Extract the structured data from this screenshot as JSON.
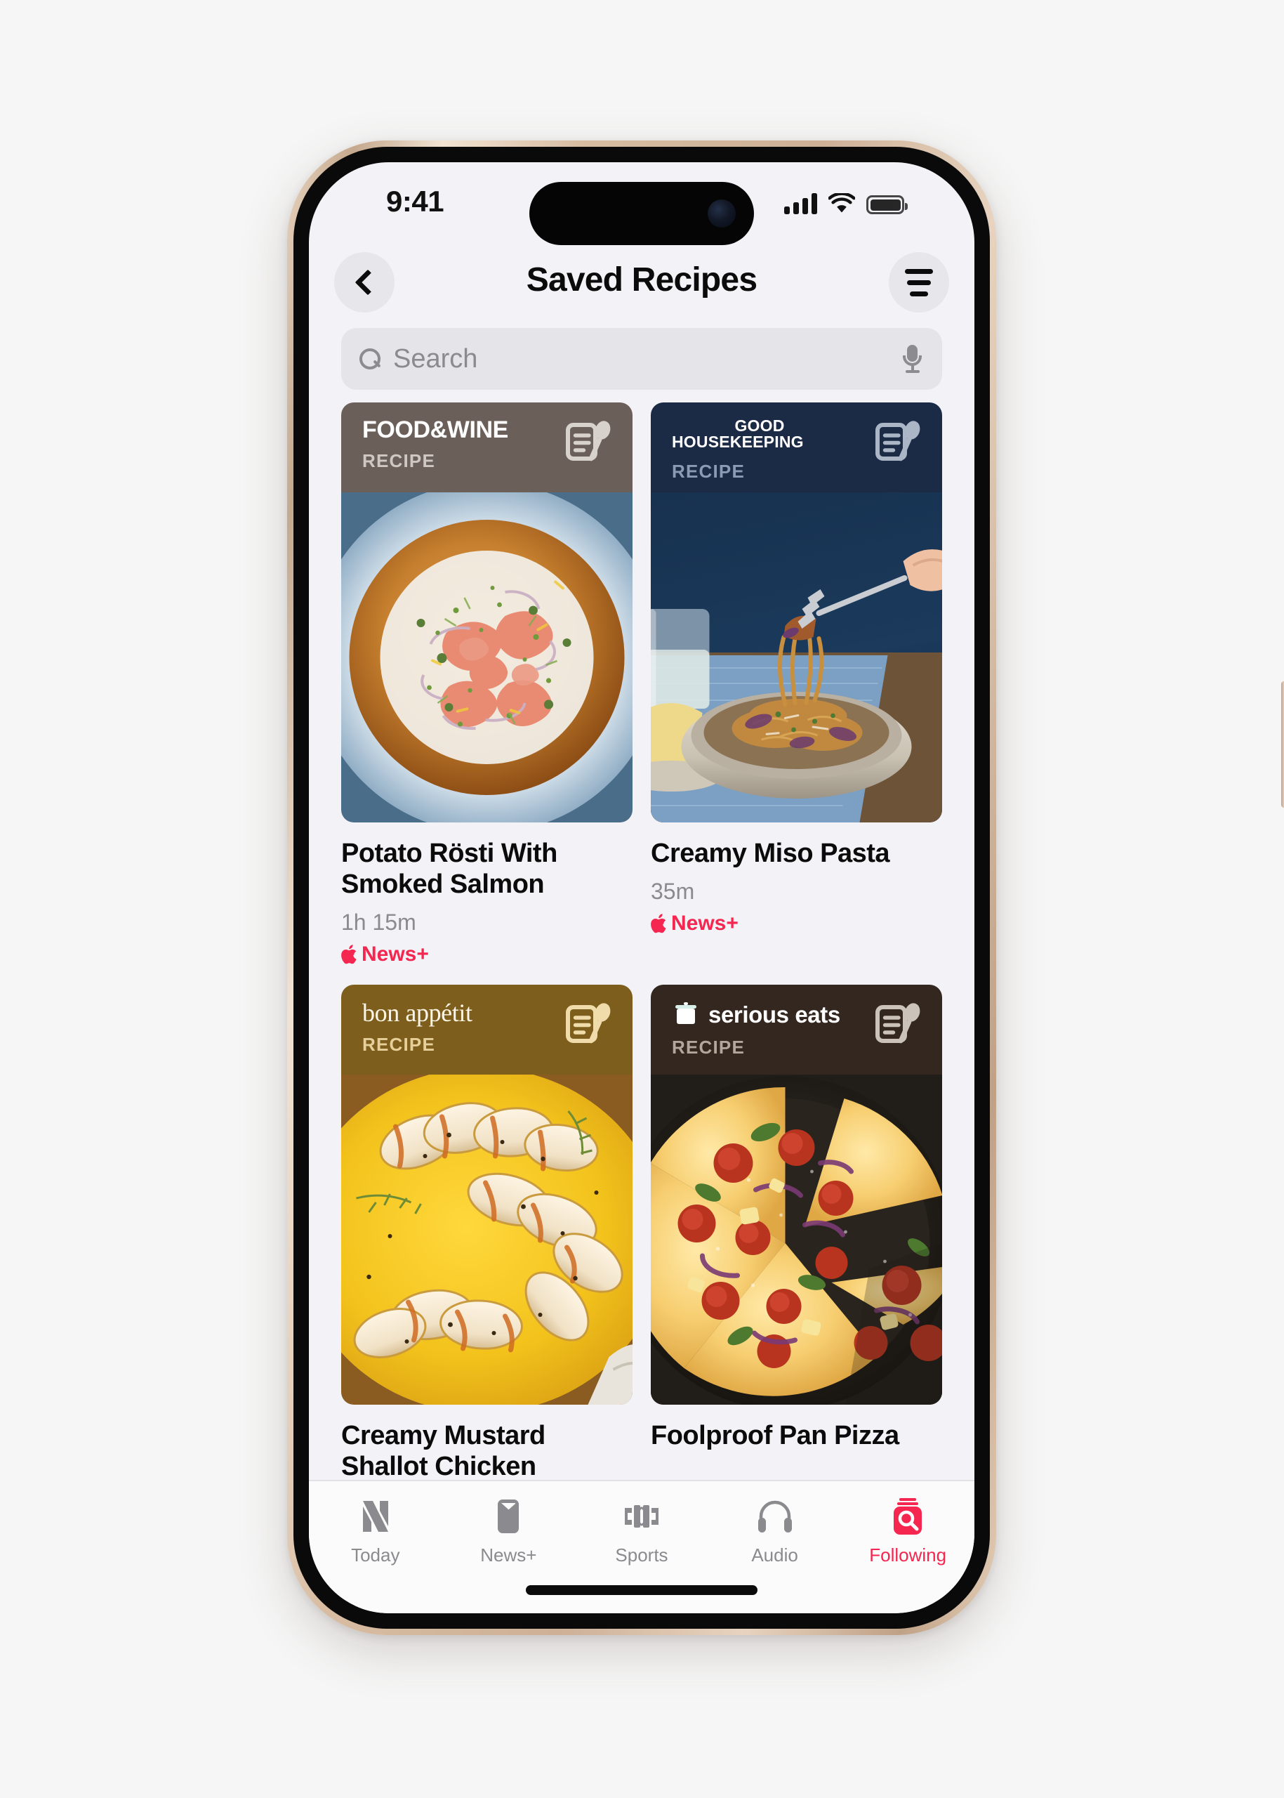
{
  "device": {
    "frame_color": "#d8bda3",
    "screen_bg": "#f2f2f7"
  },
  "status_bar": {
    "time": "9:41",
    "cellular_icon": "signal-bars-icon",
    "wifi_icon": "wifi-icon",
    "battery_icon": "battery-full-icon"
  },
  "nav": {
    "back_icon": "chevron-left-icon",
    "title": "Saved Recipes",
    "menu_icon": "filter-list-icon"
  },
  "search": {
    "placeholder": "Search",
    "value": "",
    "search_icon": "search-icon",
    "mic_icon": "microphone-icon"
  },
  "recipes": [
    {
      "publisher": "FOOD&WINE",
      "publisher_part1": "FOOD",
      "publisher_amp": "&",
      "publisher_part2": "WINE",
      "kind": "RECIPE",
      "header_bg": "#6b6059",
      "header_text": "#ffffff",
      "kind_color": "#cfc8c2",
      "icon": "recipe-card-icon",
      "icon_color": "#d8d2cc",
      "title": "Potato Rösti With Smoked Salmon",
      "time": "1h 15m",
      "badge": "News+",
      "badge_color": "#f5264f",
      "photo_alt": "potato-rosti-smoked-salmon-photo"
    },
    {
      "publisher": "GOOD HOUSEKEEPING",
      "publisher_line1": "GOOD",
      "publisher_line2": "HOUSEKEEPING",
      "kind": "RECIPE",
      "header_bg": "#1b2a45",
      "header_text": "#ffffff",
      "kind_color": "#8c9bb3",
      "icon": "recipe-card-icon",
      "icon_color": "#aab6c6",
      "title": "Creamy Miso Pasta",
      "time": "35m",
      "badge": "News+",
      "badge_color": "#f5264f",
      "photo_alt": "creamy-miso-pasta-photo"
    },
    {
      "publisher": "bon appétit",
      "kind": "RECIPE",
      "header_bg": "#7d5e1c",
      "header_text": "#fdf6e8",
      "kind_color": "#e7cf9a",
      "icon": "recipe-card-icon",
      "icon_color": "#f0dcab",
      "title": "Creamy Mustard Shallot Chicken",
      "photo_alt": "mustard-shallot-chicken-photo"
    },
    {
      "publisher": "serious eats",
      "kind": "RECIPE",
      "header_bg": "#33271f",
      "header_text": "#ffffff",
      "kind_color": "#b3a79c",
      "icon": "recipe-card-icon",
      "icon_color": "#cbc2b9",
      "logo_icon": "stockpot-icon",
      "title": "Foolproof Pan Pizza",
      "photo_alt": "foolproof-pan-pizza-photo"
    }
  ],
  "tabbar": {
    "active": "Following",
    "accent": "#f5264f",
    "inactive": "#8a8a8f",
    "items": [
      {
        "label": "Today",
        "icon": "apple-news-logo-icon"
      },
      {
        "label": "News+",
        "icon": "magazine-icon"
      },
      {
        "label": "Sports",
        "icon": "sports-field-icon"
      },
      {
        "label": "Audio",
        "icon": "headphones-icon"
      },
      {
        "label": "Following",
        "icon": "following-search-icon"
      }
    ]
  }
}
